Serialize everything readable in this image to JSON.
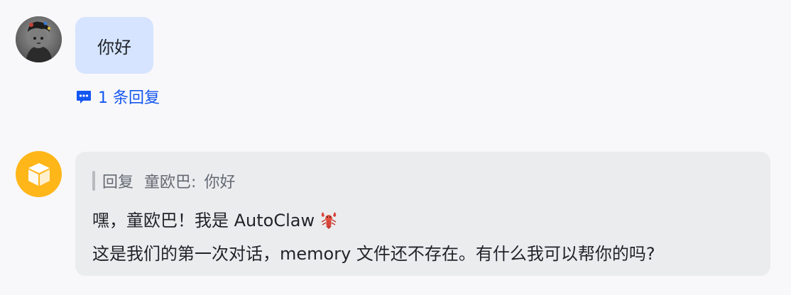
{
  "messages": [
    {
      "sender_avatar": "user-avatar-photo",
      "text": "你好",
      "thread": {
        "icon": "comment-icon",
        "label": "1 条回复"
      }
    },
    {
      "sender_avatar": "cube-icon",
      "quote": {
        "prefix": "回复",
        "author": "童欧巴:",
        "text": "你好"
      },
      "lines": [
        "嘿，童欧巴！我是 AutoClaw",
        "这是我们的第一次对话，memory 文件还不存在。有什么我可以帮你的吗?"
      ],
      "emoji": "lobster-icon"
    }
  ],
  "colors": {
    "page_bg": "#f8f8fa",
    "user_bubble": "#d6e4ff",
    "bot_bubble": "#ebecee",
    "link": "#1456f0",
    "bot_avatar": "#ffb619"
  }
}
